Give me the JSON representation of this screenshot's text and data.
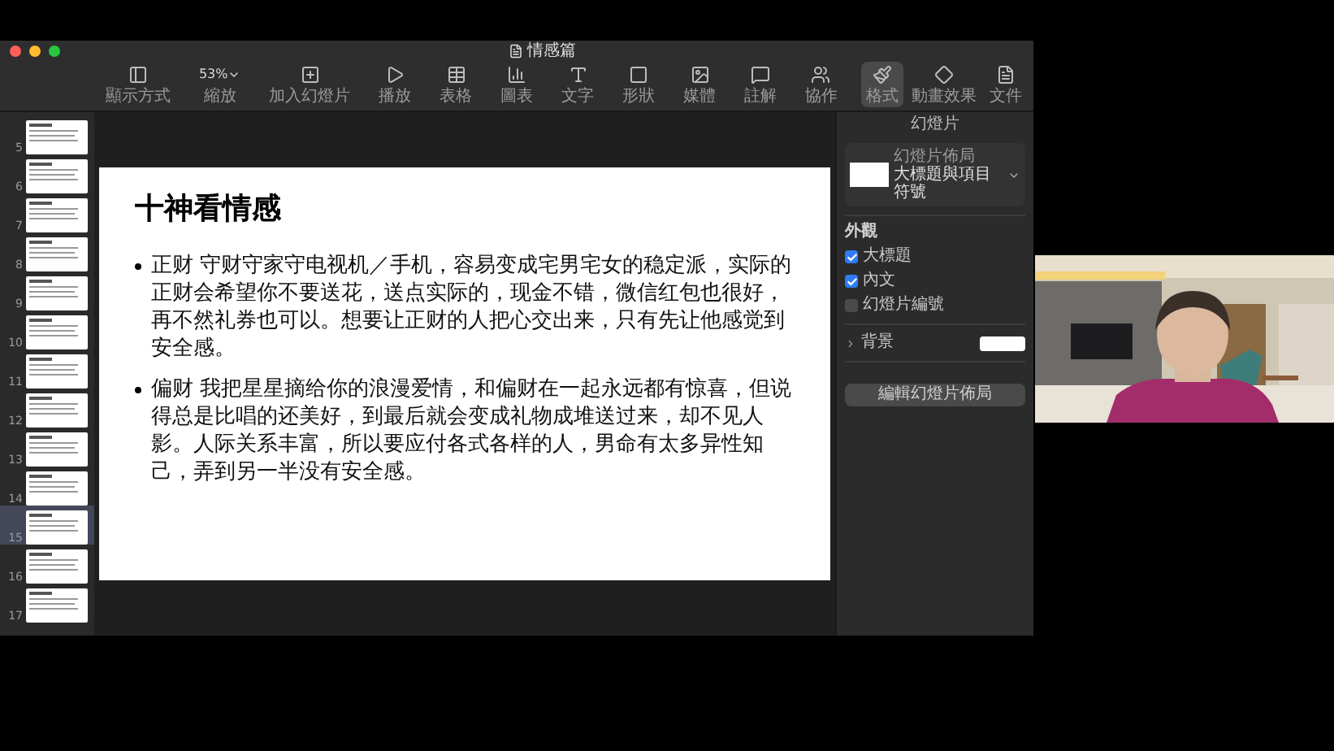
{
  "window": {
    "title": "情感篇",
    "traffic_lights": [
      {
        "color": "#ff5f57"
      },
      {
        "color": "#febc2e"
      },
      {
        "color": "#28c840"
      }
    ]
  },
  "toolbar": {
    "items": [
      {
        "kind": "view",
        "label": "顯示方式"
      },
      {
        "kind": "zoom",
        "label": "縮放",
        "value": "53%"
      },
      {
        "kind": "add-slide",
        "label": "加入幻燈片"
      },
      {
        "kind": "play",
        "label": "播放"
      },
      {
        "kind": "table",
        "label": "表格"
      },
      {
        "kind": "chart",
        "label": "圖表"
      },
      {
        "kind": "text",
        "label": "文字"
      },
      {
        "kind": "shape",
        "label": "形狀"
      },
      {
        "kind": "media",
        "label": "媒體"
      },
      {
        "kind": "comment",
        "label": "註解"
      },
      {
        "kind": "collaborate",
        "label": "協作"
      }
    ],
    "inspector_buttons": [
      {
        "kind": "format",
        "label": "格式",
        "selected": true
      },
      {
        "kind": "animate",
        "label": "動畫效果",
        "selected": false
      },
      {
        "kind": "document",
        "label": "文件",
        "selected": false
      }
    ]
  },
  "sidebar": {
    "slides": [
      {
        "number": "5",
        "selected": false
      },
      {
        "number": "6",
        "selected": false
      },
      {
        "number": "7",
        "selected": false
      },
      {
        "number": "8",
        "selected": false
      },
      {
        "number": "9",
        "selected": false
      },
      {
        "number": "10",
        "selected": false
      },
      {
        "number": "11",
        "selected": false
      },
      {
        "number": "12",
        "selected": false
      },
      {
        "number": "13",
        "selected": false
      },
      {
        "number": "14",
        "selected": false
      },
      {
        "number": "15",
        "selected": true
      },
      {
        "number": "16",
        "selected": false
      },
      {
        "number": "17",
        "selected": false
      }
    ]
  },
  "slide": {
    "title": "十神看情感",
    "bullets": [
      "正财 守财守家守电视机／手机，容易变成宅男宅女的稳定派，实际的正财会希望你不要送花，送点实际的，现金不错，微信红包也很好，再不然礼券也可以。想要让正财的人把心交出来，只有先让他感觉到安全感。",
      "偏财  我把星星摘给你的浪漫爱情，和偏财在一起永远都有惊喜，但说得总是比唱的还美好，到最后就会变成礼物成堆送过来，却不见人影。人际关系丰富，所以要应付各式各样的人，男命有太多异性知己，弄到另一半没有安全感。"
    ]
  },
  "inspector": {
    "tab": "幻燈片",
    "layout": {
      "label": "幻燈片佈局",
      "value": "大標題與項目符號"
    },
    "appearance": {
      "heading": "外觀",
      "options": [
        {
          "label": "大標題",
          "checked": true
        },
        {
          "label": "內文",
          "checked": true
        },
        {
          "label": "幻燈片編號",
          "checked": false
        }
      ]
    },
    "background": {
      "label": "背景",
      "expanded": false,
      "color": "#ffffff"
    },
    "button": "編輯幻燈片佈局"
  }
}
